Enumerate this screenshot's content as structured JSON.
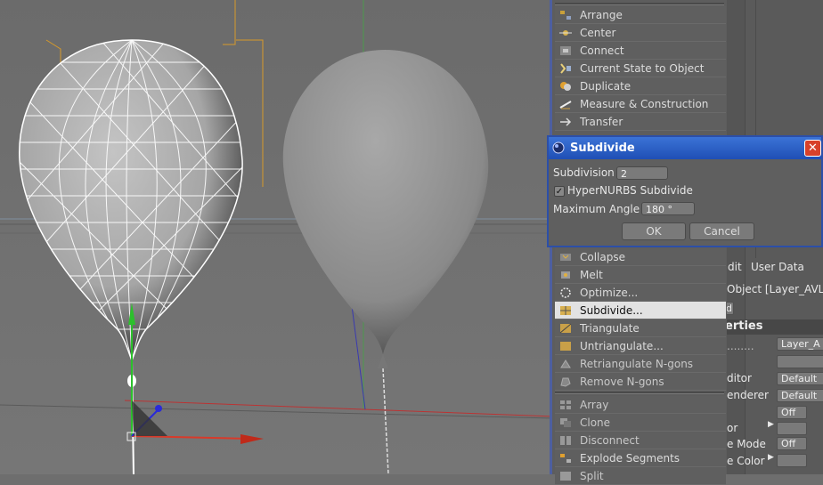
{
  "menu_top": [
    {
      "label": "Arrange",
      "icon": "arrange-icon"
    },
    {
      "label": "Center",
      "icon": "center-icon"
    },
    {
      "label": "Connect",
      "icon": "connect-icon"
    },
    {
      "label": "Current State to Object",
      "icon": "current-state-icon"
    },
    {
      "label": "Duplicate",
      "icon": "duplicate-icon"
    },
    {
      "label": "Measure & Construction",
      "icon": "measure-icon"
    },
    {
      "label": "Transfer",
      "icon": "transfer-icon"
    }
  ],
  "menu_mid": [
    {
      "label": "Collapse",
      "icon": "collapse-icon"
    },
    {
      "label": "Melt",
      "icon": "melt-icon"
    },
    {
      "label": "Optimize...",
      "icon": "optimize-icon"
    },
    {
      "label": "Subdivide...",
      "icon": "subdivide-icon",
      "highlighted": true
    },
    {
      "label": "Triangulate",
      "icon": "triangulate-icon"
    },
    {
      "label": "Untriangulate...",
      "icon": "untriangulate-icon"
    },
    {
      "label": "Retriangulate N-gons",
      "icon": "retriangulate-icon"
    },
    {
      "label": "Remove N-gons",
      "icon": "remove-ngons-icon"
    }
  ],
  "menu_bottom": [
    {
      "label": "Array",
      "icon": "array-icon"
    },
    {
      "label": "Clone",
      "icon": "clone-icon"
    },
    {
      "label": "Disconnect",
      "icon": "disconnect-icon"
    },
    {
      "label": "Explode Segments",
      "icon": "explode-icon"
    },
    {
      "label": "Split",
      "icon": "split-icon"
    }
  ],
  "dialog": {
    "title": "Subdivide",
    "close": "✕",
    "subdivision_label": "Subdivision",
    "subdivision_value": "2",
    "hypernurbs_label": "HyperNURBS Subdivide",
    "hypernurbs_checked": "✓",
    "max_angle_label": "Maximum Angle",
    "max_angle_value": "180 °",
    "ok": "OK",
    "cancel": "Cancel"
  },
  "attributes": {
    "tab_edit": "dit",
    "tab_userdata": "User Data",
    "object_title": "Object [Layer_AVLa",
    "sub_button": "d",
    "properties_header": "erties",
    "field_layer": "Layer_A",
    "label_editor": "ditor",
    "value_editor": "Default",
    "label_renderer": "enderer",
    "value_renderer": "Default",
    "value_off1": "Off",
    "label_color": "or",
    "label_mode": "e Mode",
    "value_off2": "Off",
    "label_usecolor": "e Color"
  },
  "colors": {
    "highlight": "#e2e2e2",
    "dialog_title": "#2f62c8",
    "close": "#d8412a",
    "menu_bg": "#5d5d5d"
  }
}
